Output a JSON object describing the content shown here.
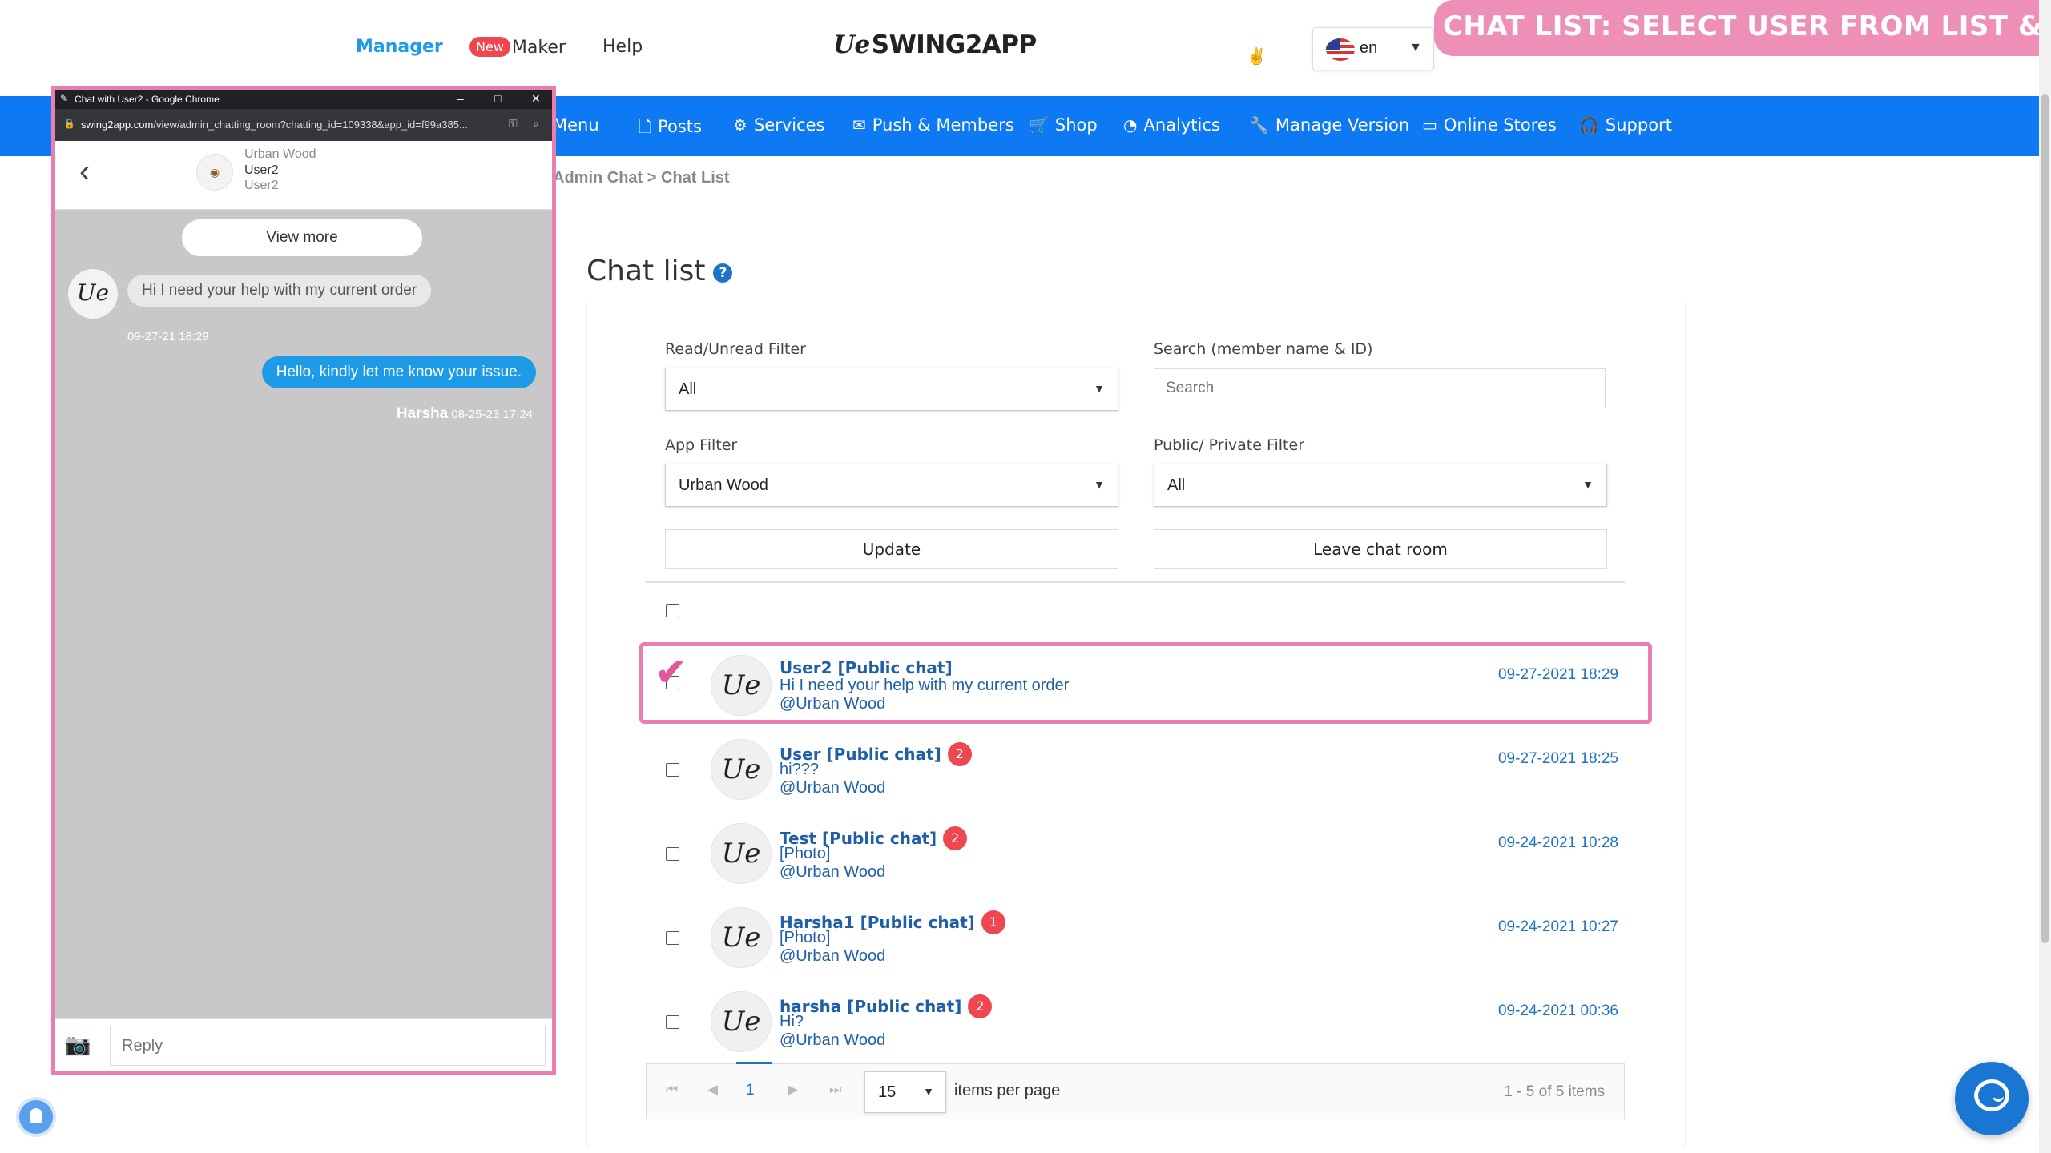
{
  "header": {
    "nav_manager": "Manager",
    "new_badge": "New",
    "nav_maker": "Maker",
    "nav_help": "Help",
    "logo_mark": "Ue",
    "logo_text": "SWING2APP",
    "lang": "en",
    "banner": "CHAT LIST: SELECT USER FROM LIST & CHAT"
  },
  "main_nav": [
    {
      "label": "Menu",
      "icon": "menu-icon"
    },
    {
      "label": "Posts",
      "icon": "document-icon"
    },
    {
      "label": "Services",
      "icon": "gear-icon"
    },
    {
      "label": "Push & Members",
      "icon": "mail-icon"
    },
    {
      "label": "Shop",
      "icon": "cart-icon"
    },
    {
      "label": "Analytics",
      "icon": "pie-chart-icon"
    },
    {
      "label": "Manage Version",
      "icon": "wrench-icon"
    },
    {
      "label": "Online Stores",
      "icon": "card-icon"
    },
    {
      "label": "Support",
      "icon": "headset-icon"
    }
  ],
  "breadcrumb": "Admin Chat > Chat List",
  "page_title": "Chat list",
  "filters": {
    "read_unread_label": "Read/Unread Filter",
    "read_unread_value": "All",
    "search_label": "Search (member name & ID)",
    "search_placeholder": "Search",
    "app_filter_label": "App Filter",
    "app_filter_value": "Urban Wood",
    "public_private_label": "Public/ Private Filter",
    "public_private_value": "All",
    "update_button": "Update",
    "leave_button": "Leave chat room"
  },
  "chats": [
    {
      "name": "User2 [Public chat]",
      "message": "Hi I need your help with my current order",
      "app": "@Urban Wood",
      "time": "09-27-2021 18:29",
      "unread": "",
      "checked": true
    },
    {
      "name": "User [Public chat]",
      "message": "hi???",
      "app": "@Urban Wood",
      "time": "09-27-2021 18:25",
      "unread": "2",
      "checked": false
    },
    {
      "name": "Test [Public chat]",
      "message": "[Photo]",
      "app": "@Urban Wood",
      "time": "09-24-2021 10:28",
      "unread": "2",
      "checked": false
    },
    {
      "name": "Harsha1 [Public chat]",
      "message": "[Photo]",
      "app": "@Urban Wood",
      "time": "09-24-2021 10:27",
      "unread": "1",
      "checked": false
    },
    {
      "name": "harsha [Public chat]",
      "message": "Hi?",
      "app": "@Urban Wood",
      "time": "09-24-2021 00:36",
      "unread": "2",
      "checked": false
    }
  ],
  "pagination": {
    "current_page": "1",
    "per_page": "15",
    "per_page_label": "items per page",
    "count": "1 - 5 of 5 items"
  },
  "popup": {
    "window_title": "Chat with User2 - Google Chrome",
    "url_host": "swing2app.com",
    "url_path": "/view/admin_chatting_room?chatting_id=109338&app_id=f99a385...",
    "room_app": "Urban Wood",
    "room_user": "User2",
    "room_user_sub": "User2",
    "view_more": "View more",
    "incoming_message": "Hi I need your help with my current order",
    "incoming_time": "09-27-21 18:29",
    "outgoing_message": "Hello, kindly let me know your issue.",
    "outgoing_sender": "Harsha",
    "outgoing_time": "08-25-23 17:24",
    "reply_placeholder": "Reply"
  }
}
